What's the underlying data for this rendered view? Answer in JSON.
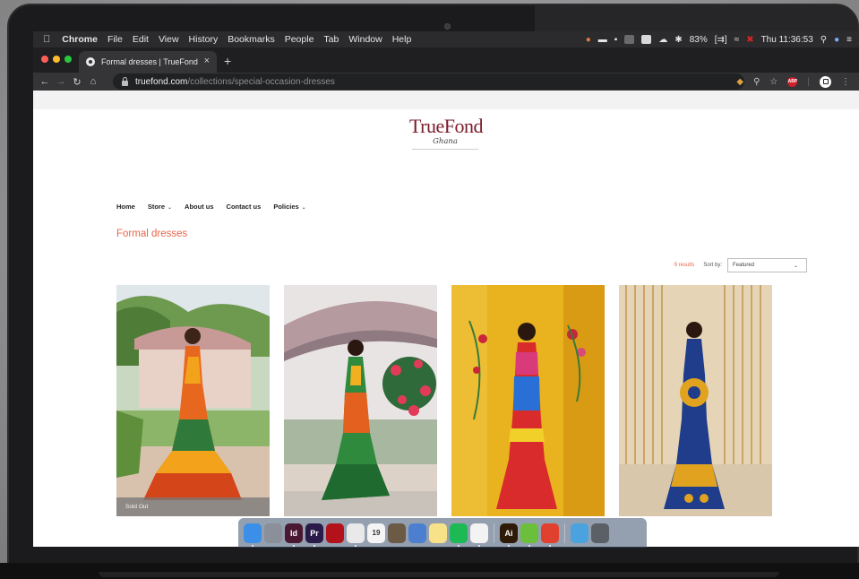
{
  "menubar": {
    "apple_icon": "apple-icon",
    "app_name": "Chrome",
    "items": [
      "File",
      "Edit",
      "View",
      "History",
      "Bookmarks",
      "People",
      "Tab",
      "Window",
      "Help"
    ],
    "battery": "83%",
    "clock": "Thu 11:36:53"
  },
  "browser": {
    "tab_title": "Formal dresses | TrueFond",
    "tab_close": "×",
    "new_tab": "+",
    "url_host": "truefond.com",
    "url_path": "/collections/special-occasion-dresses",
    "abp_label": "ABP"
  },
  "site": {
    "logo_text": "TrueFond",
    "logo_sub": "Ghana",
    "nav": [
      {
        "label": "Home",
        "dropdown": false
      },
      {
        "label": "Store",
        "dropdown": true
      },
      {
        "label": "About us",
        "dropdown": false
      },
      {
        "label": "Contact us",
        "dropdown": false
      },
      {
        "label": "Policies",
        "dropdown": true
      }
    ],
    "collection_title": "Formal dresses",
    "results_count": "9 results",
    "sort_label": "Sort by:",
    "sort_value": "Featured"
  },
  "products": [
    {
      "badge": "Sold Out",
      "dress": "kente-ruffle"
    },
    {
      "badge": "",
      "dress": "green-mermaid"
    },
    {
      "badge": "",
      "dress": "red-corset"
    },
    {
      "badge": "",
      "dress": "blue-gold-halter"
    }
  ],
  "dock": {
    "apps": [
      {
        "name": "finder-icon",
        "label": "",
        "color": "#3c8fe8"
      },
      {
        "name": "launchpad-icon",
        "label": "",
        "color": "#8a8f99"
      },
      {
        "name": "indesign-icon",
        "label": "Id",
        "color": "#4a1830"
      },
      {
        "name": "premiere-icon",
        "label": "Pr",
        "color": "#2a1a4a"
      },
      {
        "name": "acrobat-icon",
        "label": "",
        "color": "#b3121b"
      },
      {
        "name": "chrome-icon",
        "label": "",
        "color": "#e9e9e9"
      },
      {
        "name": "calendar-icon",
        "label": "19",
        "color": "#f4f4f4"
      },
      {
        "name": "notebook-icon",
        "label": "",
        "color": "#6a5a46"
      },
      {
        "name": "preview-icon",
        "label": "",
        "color": "#4c7fd0"
      },
      {
        "name": "notes-icon",
        "label": "",
        "color": "#f7e28a"
      },
      {
        "name": "spotify-icon",
        "label": "",
        "color": "#1db954"
      },
      {
        "name": "slack-icon",
        "label": "",
        "color": "#f3f3f3"
      },
      {
        "name": "illustrator-icon",
        "label": "Ai",
        "color": "#2e1a06"
      },
      {
        "name": "utorrent-icon",
        "label": "",
        "color": "#6bbf3a"
      },
      {
        "name": "bookmark-app-icon",
        "label": "",
        "color": "#e1402e"
      },
      {
        "name": "downloads-folder-icon",
        "label": "",
        "color": "#4aa3df"
      },
      {
        "name": "trash-icon",
        "label": "",
        "color": "#5b5f66"
      }
    ]
  }
}
